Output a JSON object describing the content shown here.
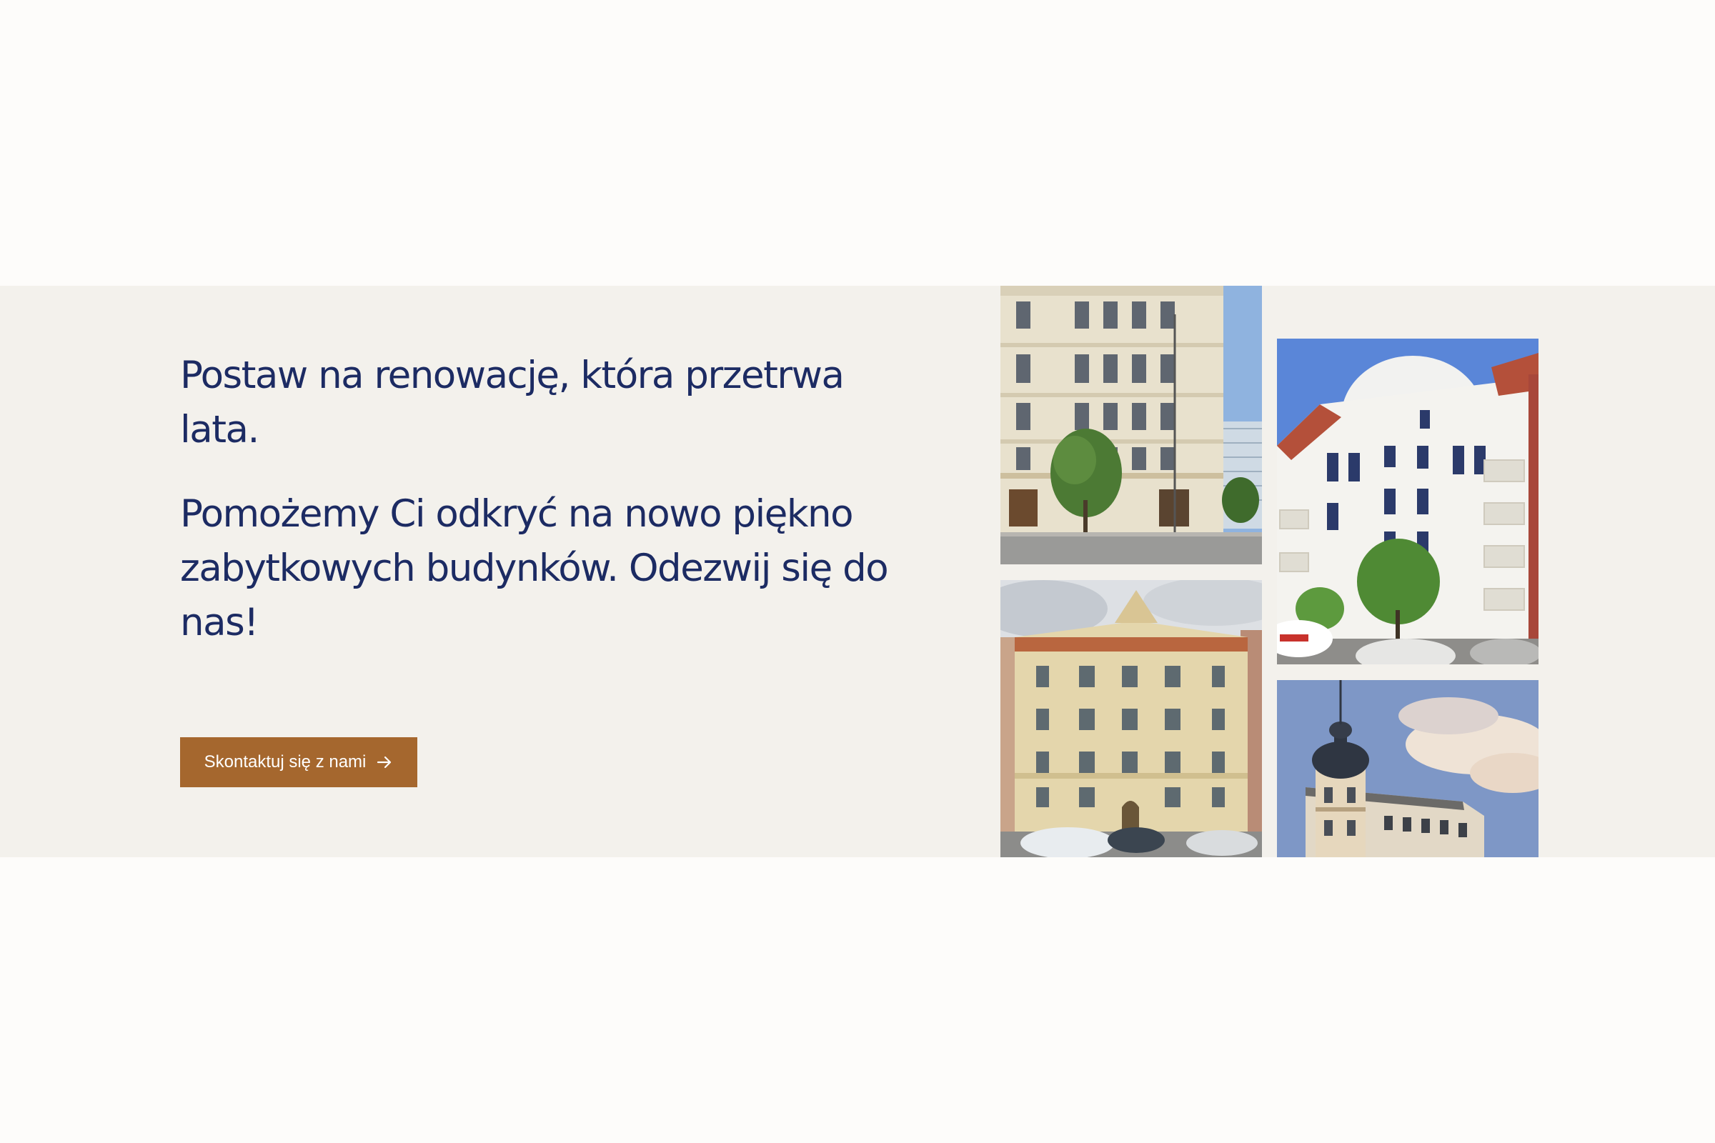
{
  "cta": {
    "headline_1": "Postaw na renowację, która przetrwa lata.",
    "headline_2": "Pomożemy Ci odkryć na nowo piękno zabytkowych budynków. Odezwij się do nas!",
    "button_label": "Skontaktuj się z nami"
  },
  "gallery": {
    "icons": [
      "arrow-right-icon"
    ]
  },
  "colors": {
    "background": "#fdfcfa",
    "band": "#f3f1ec",
    "headline": "#1c2b63",
    "button": "#a5672e",
    "button_text": "#ffffff"
  }
}
